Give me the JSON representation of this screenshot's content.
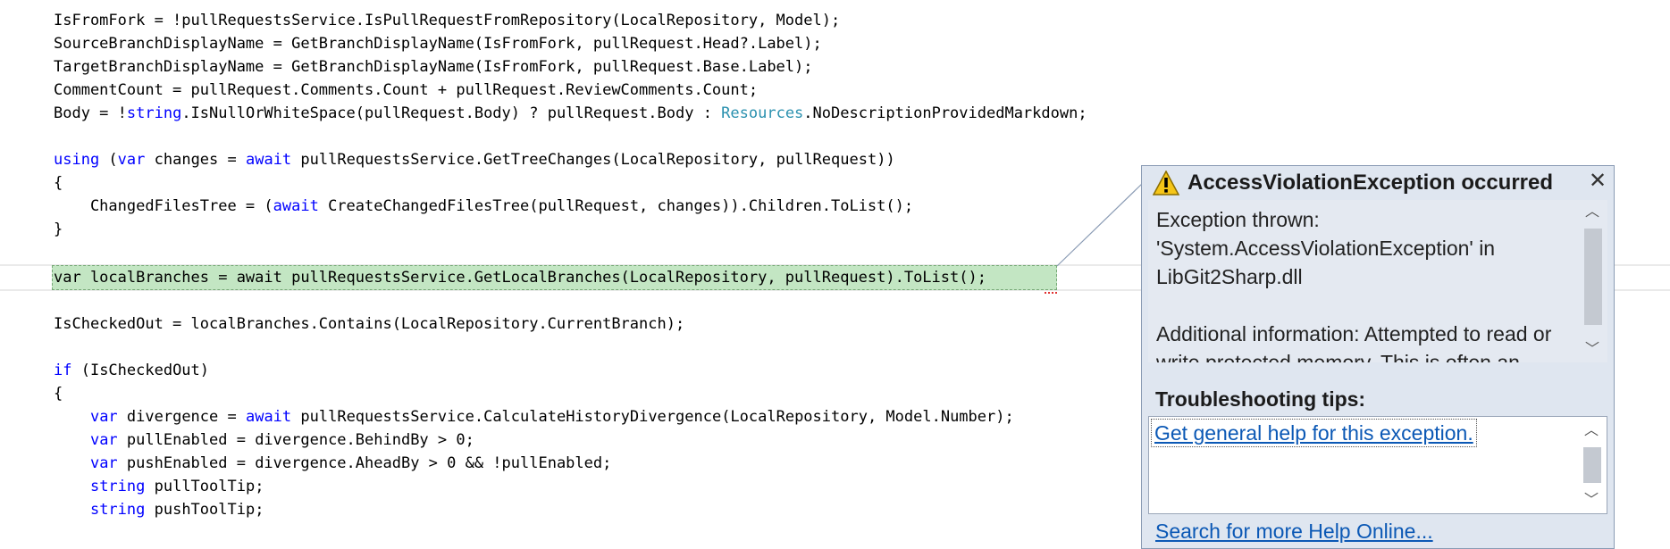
{
  "code_lines": [
    [
      {
        "t": "IsFromFork = !pullRequestsService.IsPullRequestFromRepository(LocalRepository, Model);"
      }
    ],
    [
      {
        "t": "SourceBranchDisplayName = GetBranchDisplayName(IsFromFork, pullRequest.Head?.Label);"
      }
    ],
    [
      {
        "t": "TargetBranchDisplayName = GetBranchDisplayName(IsFromFork, pullRequest.Base.Label);"
      }
    ],
    [
      {
        "t": "CommentCount = pullRequest.Comments.Count + pullRequest.ReviewComments.Count;"
      }
    ],
    [
      {
        "t": "Body = !"
      },
      {
        "t": "string",
        "c": "kw"
      },
      {
        "t": ".IsNullOrWhiteSpace(pullRequest.Body) ? pullRequest.Body : "
      },
      {
        "t": "Resources",
        "c": "ty"
      },
      {
        "t": ".NoDescriptionProvidedMarkdown;"
      }
    ],
    [
      {
        "t": "using",
        "c": "kw"
      },
      {
        "t": " ("
      },
      {
        "t": "var",
        "c": "kw"
      },
      {
        "t": " changes = "
      },
      {
        "t": "await",
        "c": "kw"
      },
      {
        "t": " pullRequestsService.GetTreeChanges(LocalRepository, pullRequest))"
      }
    ],
    [
      {
        "t": "{"
      }
    ],
    [
      {
        "t": "    ChangedFilesTree = ("
      },
      {
        "t": "await",
        "c": "kw"
      },
      {
        "t": " CreateChangedFilesTree(pullRequest, changes)).Children.ToList();"
      }
    ],
    [
      {
        "t": "}"
      }
    ],
    [
      {
        "t": "var localBranches = await pullRequestsService.GetLocalBranches(LocalRepository, pullRequest).ToList();"
      }
    ],
    [
      {
        "t": "IsCheckedOut = localBranches.Contains(LocalRepository.CurrentBranch);"
      }
    ],
    [
      {
        "t": "if",
        "c": "kw"
      },
      {
        "t": " (IsCheckedOut)"
      }
    ],
    [
      {
        "t": "{"
      }
    ],
    [
      {
        "t": "    "
      },
      {
        "t": "var",
        "c": "kw"
      },
      {
        "t": " divergence = "
      },
      {
        "t": "await",
        "c": "kw"
      },
      {
        "t": " pullRequestsService.CalculateHistoryDivergence(LocalRepository, Model.Number);"
      }
    ],
    [
      {
        "t": "    "
      },
      {
        "t": "var",
        "c": "kw"
      },
      {
        "t": " pullEnabled = divergence.BehindBy > 0;"
      }
    ],
    [
      {
        "t": "    "
      },
      {
        "t": "var",
        "c": "kw"
      },
      {
        "t": " pushEnabled = divergence.AheadBy > 0 && !pullEnabled;"
      }
    ],
    [
      {
        "t": "    "
      },
      {
        "t": "string",
        "c": "kw"
      },
      {
        "t": " pullToolTip;"
      }
    ],
    [
      {
        "t": "    "
      },
      {
        "t": "string",
        "c": "kw"
      },
      {
        "t": " pushToolTip;"
      }
    ]
  ],
  "colors": {
    "keyword": "#0000ff",
    "type": "#2b91af",
    "highlight": "#c3e6c3",
    "link": "#0b58b5"
  },
  "exception": {
    "title": "AccessViolationException occurred",
    "icon": "warning-icon",
    "close_glyph": "✕",
    "details_1": "Exception thrown: 'System.AccessViolationException' in LibGit2Sharp.dll",
    "details_2": "Additional information: Attempted to read or write protected memory. This is often an indication that other memory is corrupt.",
    "tips_title": "Troubleshooting tips:",
    "tips_link": "Get general help for this exception.",
    "search_link": "Search for more Help Online..."
  }
}
